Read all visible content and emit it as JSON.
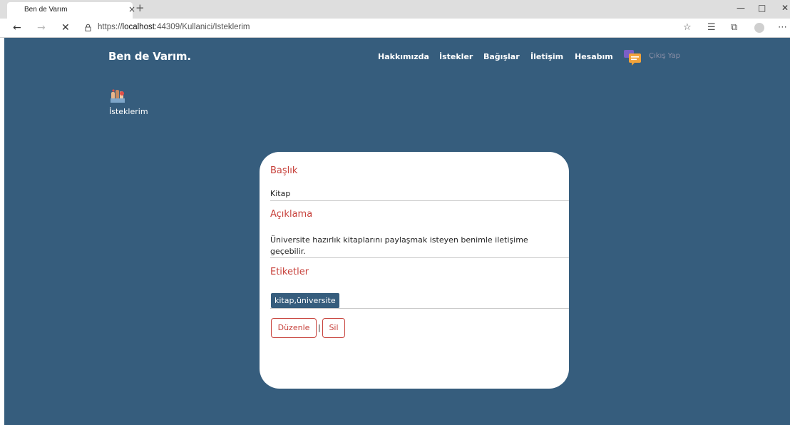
{
  "browser": {
    "tab_title": "Ben de Varım",
    "tab_close": "×",
    "new_tab": "+",
    "url_prefix": "https://",
    "url_host": "localhost",
    "url_path": ":44309/Kullanici/Isteklerim",
    "icons": [
      "back-icon",
      "forward-icon",
      "stop-icon",
      "lock-icon",
      "star-icon",
      "favorites-icon",
      "collections-icon",
      "profile-icon",
      "more-icon",
      "minimize-icon",
      "maximize-icon",
      "close-icon"
    ]
  },
  "header": {
    "brand": "Ben de Varım.",
    "nav": [
      "Hakkımızda",
      "İstekler",
      "Bağışlar",
      "İletişim",
      "Hesabım"
    ],
    "logout": "Çıkış Yap"
  },
  "section": {
    "label": "İsteklerim"
  },
  "card": {
    "title_label": "Başlık",
    "title_value": "Kitap",
    "desc_label": "Açıklama",
    "desc_value": "Üniversite hazırlık kitaplarını paylaşmak isteyen benimle iletişime geçebilir.",
    "tags_label": "Etiketler",
    "tags_value": "kitap,üniversite",
    "edit_button": "Düzenle",
    "separator": "|",
    "delete_button": "Sil"
  },
  "colors": {
    "page_bg": "#365d7d",
    "accent": "#c7413b",
    "card_bg": "#ffffff"
  }
}
